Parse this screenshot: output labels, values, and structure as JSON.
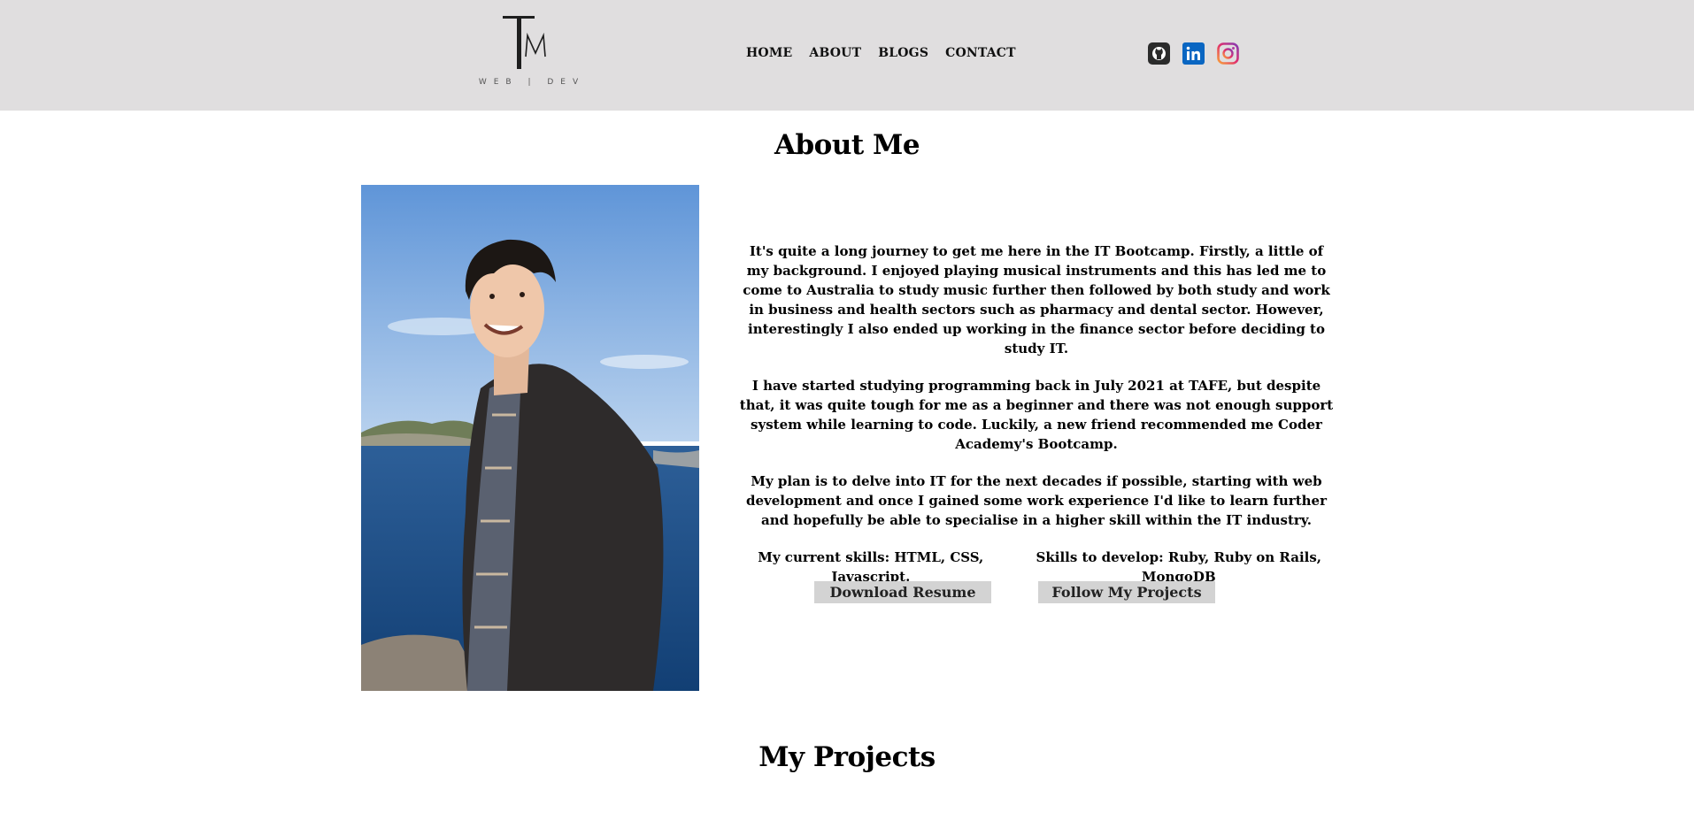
{
  "header": {
    "logo": {
      "mark": "TM",
      "subtitle": "WEB | DEV"
    },
    "nav": [
      "HOME",
      "ABOUT",
      "BLOGS",
      "CONTACT"
    ],
    "social": [
      {
        "name": "github-icon",
        "color": "#2b2b2b"
      },
      {
        "name": "linkedin-icon",
        "color": "#0a66c2"
      },
      {
        "name": "instagram-icon",
        "color": "#c13584"
      }
    ],
    "background": "#e0dedf"
  },
  "about": {
    "title": "About Me",
    "paragraphs": [
      "It's quite a long journey to get me here in the IT Bootcamp. Firstly, a little of my background. I enjoyed playing musical instruments and this has led me to come to Australia to study music further then followed by both study and work in business and health sectors such as pharmacy and dental sector. However, interestingly I also ended up working in the finance sector before deciding to study IT.",
      "I have started studying programming back in July 2021 at TAFE, but despite that, it was quite tough for me as a beginner and there was not enough support system while learning to code. Luckily, a new friend recommended me Coder Academy's Bootcamp.",
      "My plan is to delve into IT for the next decades if possible, starting with web development and once I gained some work experience I'd like to learn further and hopefully be able to specialise in a higher skill within the IT industry."
    ],
    "skills_current": "My current skills: HTML, CSS, Javascript.",
    "skills_develop": "Skills to develop: Ruby, Ruby on Rails, MongoDB",
    "buttons": {
      "resume": "Download Resume",
      "projects": "Follow My Projects"
    }
  },
  "projects": {
    "title": "My Projects"
  }
}
